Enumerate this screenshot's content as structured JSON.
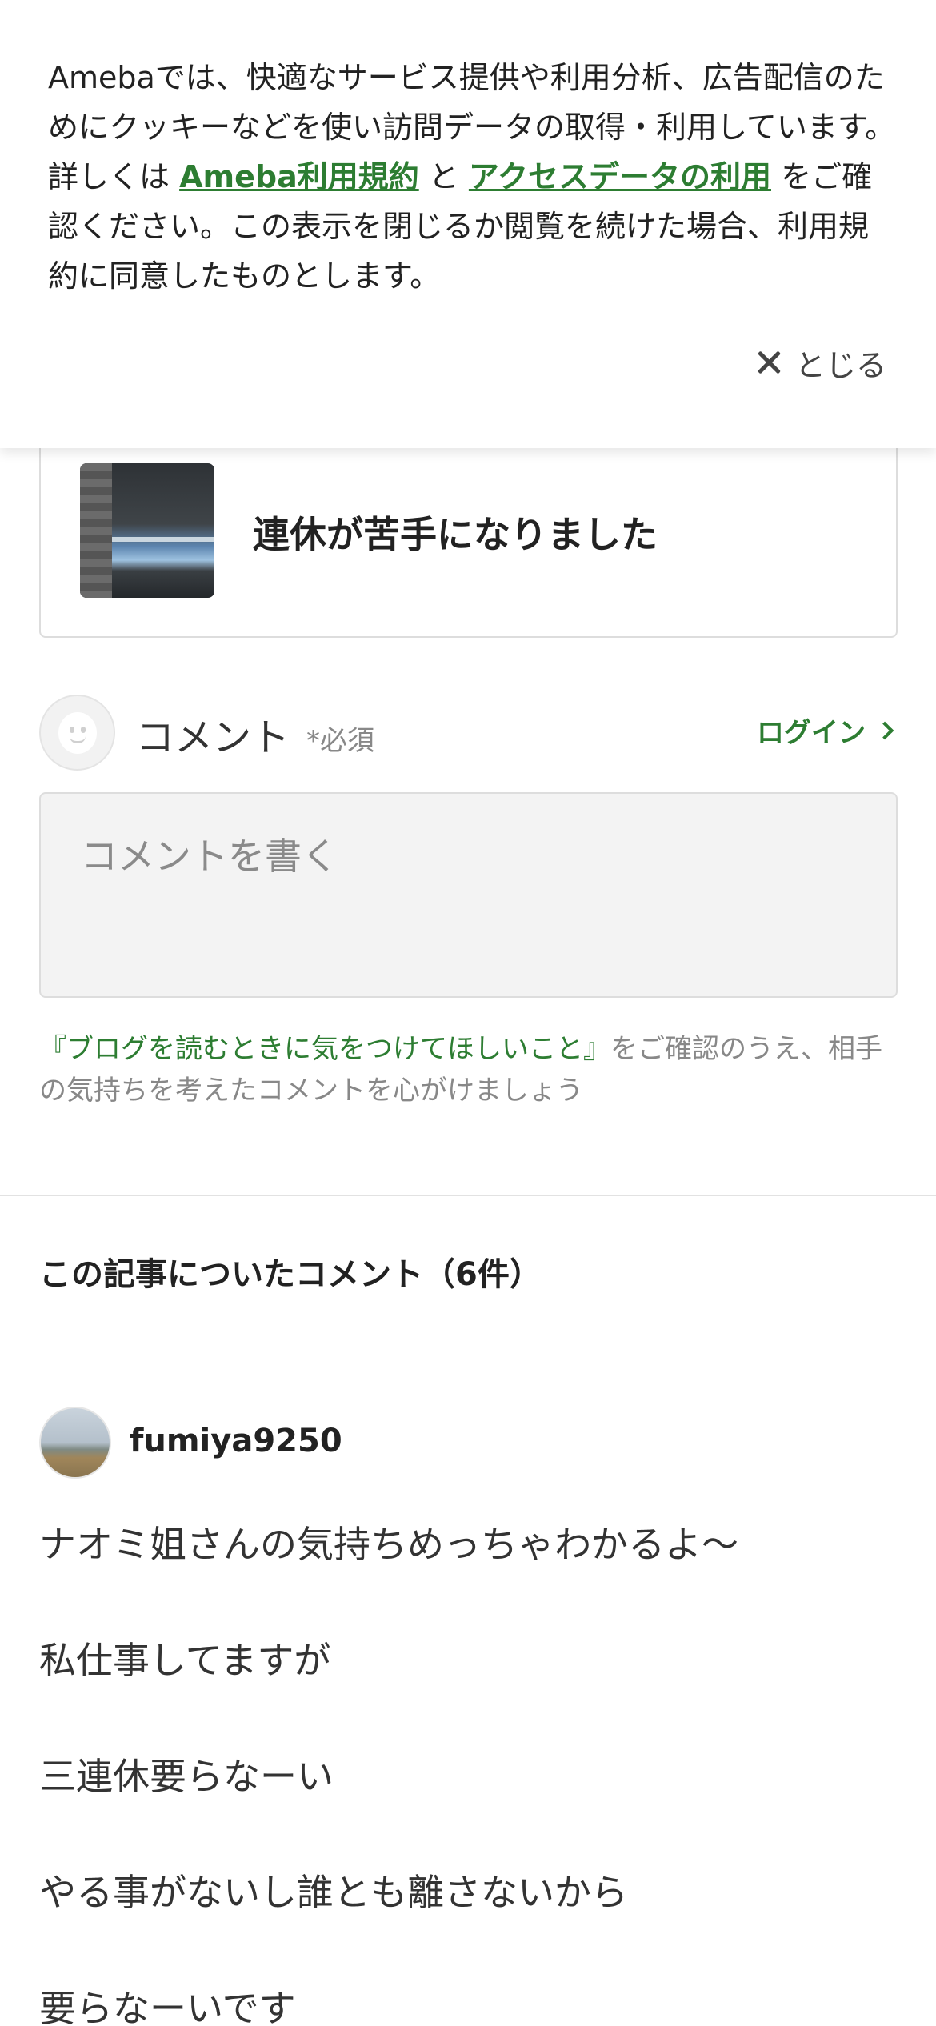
{
  "cookie_banner": {
    "text_part1": "Amebaでは、快適なサービス提供や利用分析、広告配信のためにクッキーなどを使い訪問データの取得・利用しています。詳しくは ",
    "link_terms": "Ameba利用規約",
    "text_and": " と ",
    "link_access": "アクセスデータの利用",
    "text_part2": " をご確認ください。この表示を閉じるか閲覧を続けた場合、利用規約に同意したものとします。",
    "close_label": "とじる"
  },
  "article": {
    "title": "連休が苦手になりました"
  },
  "comment_form": {
    "label": "コメント",
    "required": "*必須",
    "login_label": "ログイン",
    "placeholder": "コメントを書く",
    "guideline_link": "『ブログを読むときに気をつけてほしいこと』",
    "guideline_text": "をご確認のうえ、相手の気持ちを考えたコメントを心がけましょう"
  },
  "comments": {
    "heading": "この記事についたコメント（6件）",
    "items": [
      {
        "username": "fumiya9250",
        "lines": [
          "ナオミ姐さんの気持ちめっちゃわかるよ〜",
          "私仕事してますが",
          "三連休要らなーい",
          "やる事がないし誰とも離さないから",
          "要らなーいです"
        ]
      }
    ]
  },
  "colors": {
    "accent_green": "#2d7d32",
    "text_primary": "#333333",
    "text_muted": "#888888"
  },
  "icons": [
    "close-icon",
    "chevron-right-icon",
    "default-avatar-icon"
  ]
}
